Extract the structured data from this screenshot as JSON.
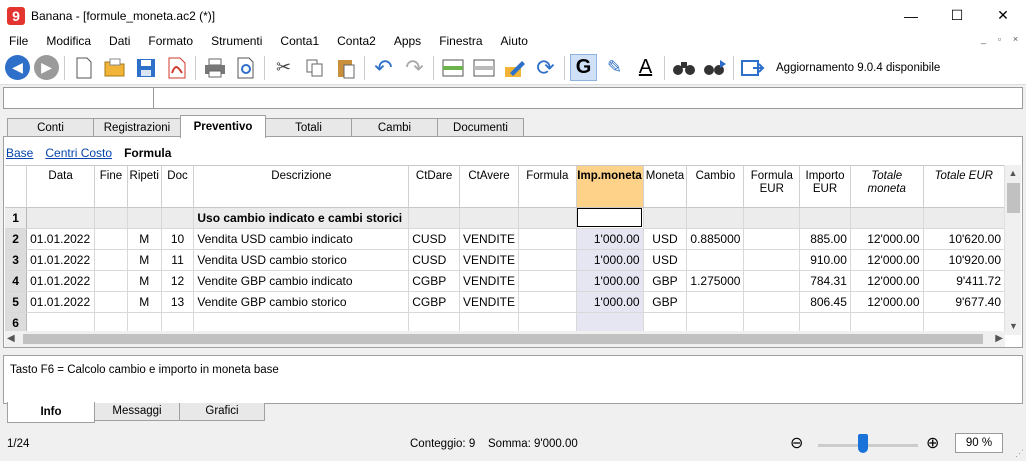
{
  "window": {
    "title": "Banana - [formule_moneta.ac2 (*)]",
    "logo": "9",
    "controls": [
      "—",
      "☐",
      "✕"
    ]
  },
  "menu": [
    "File",
    "Modifica",
    "Dati",
    "Formato",
    "Strumenti",
    "Conta1",
    "Conta2",
    "Apps",
    "Finestra",
    "Aiuto"
  ],
  "menu_right": [
    "_",
    "▫",
    "×"
  ],
  "toolbar": {
    "update_text": "Aggiornamento 9.0.4 disponibile",
    "bold_glyph": "G",
    "font_color_glyph": "A"
  },
  "tabs": [
    {
      "label": "Conti",
      "active": false
    },
    {
      "label": "Registrazioni",
      "active": false
    },
    {
      "label": "Preventivo",
      "active": true
    },
    {
      "label": "Totali",
      "active": false
    },
    {
      "label": "Cambi",
      "active": false
    },
    {
      "label": "Documenti",
      "active": false
    }
  ],
  "views": {
    "base": "Base",
    "centri": "Centri Costo",
    "formula": "Formula"
  },
  "columns": {
    "data": "Data",
    "fine": "Fine",
    "ripeti": "Ripeti",
    "doc": "Doc",
    "descrizione": "Descrizione",
    "ctdare": "CtDare",
    "ctavere": "CtAvere",
    "formula": "Formula",
    "imp_moneta": "Imp.moneta",
    "moneta": "Moneta",
    "cambio": "Cambio",
    "formula_eur": "Formula EUR",
    "importo_eur": "Importo EUR",
    "totale_moneta": "Totale moneta",
    "totale_eur": "Totale EUR"
  },
  "rows": [
    {
      "n": "1",
      "data": "",
      "fine": "",
      "ripeti": "",
      "doc": "",
      "descrizione": "Uso cambio indicato e cambi storici",
      "ctdare": "",
      "ctavere": "",
      "formula": "",
      "imp_moneta": "",
      "moneta": "",
      "cambio": "",
      "formula_eur": "",
      "importo_eur": "",
      "totale_moneta": "",
      "totale_eur": ""
    },
    {
      "n": "2",
      "data": "01.01.2022",
      "fine": "",
      "ripeti": "M",
      "doc": "10",
      "descrizione": "Vendita USD cambio indicato",
      "ctdare": "CUSD",
      "ctavere": "VENDITE",
      "formula": "",
      "imp_moneta": "1'000.00",
      "moneta": "USD",
      "cambio": "0.885000",
      "formula_eur": "",
      "importo_eur": "885.00",
      "totale_moneta": "12'000.00",
      "totale_eur": "10'620.00"
    },
    {
      "n": "3",
      "data": "01.01.2022",
      "fine": "",
      "ripeti": "M",
      "doc": "11",
      "descrizione": "Vendita USD cambio storico",
      "ctdare": "CUSD",
      "ctavere": "VENDITE",
      "formula": "",
      "imp_moneta": "1'000.00",
      "moneta": "USD",
      "cambio": "",
      "formula_eur": "",
      "importo_eur": "910.00",
      "totale_moneta": "12'000.00",
      "totale_eur": "10'920.00"
    },
    {
      "n": "4",
      "data": "01.01.2022",
      "fine": "",
      "ripeti": "M",
      "doc": "12",
      "descrizione": "Vendite GBP cambio indicato",
      "ctdare": "CGBP",
      "ctavere": "VENDITE",
      "formula": "",
      "imp_moneta": "1'000.00",
      "moneta": "GBP",
      "cambio": "1.275000",
      "formula_eur": "",
      "importo_eur": "784.31",
      "totale_moneta": "12'000.00",
      "totale_eur": "9'411.72"
    },
    {
      "n": "5",
      "data": "01.01.2022",
      "fine": "",
      "ripeti": "M",
      "doc": "13",
      "descrizione": "Vendite GBP cambio storico",
      "ctdare": "CGBP",
      "ctavere": "VENDITE",
      "formula": "",
      "imp_moneta": "1'000.00",
      "moneta": "GBP",
      "cambio": "",
      "formula_eur": "",
      "importo_eur": "806.45",
      "totale_moneta": "12'000.00",
      "totale_eur": "9'677.40"
    },
    {
      "n": "6",
      "data": "",
      "fine": "",
      "ripeti": "",
      "doc": "",
      "descrizione": "",
      "ctdare": "",
      "ctavere": "",
      "formula": "",
      "imp_moneta": "",
      "moneta": "",
      "cambio": "",
      "formula_eur": "",
      "importo_eur": "",
      "totale_moneta": "",
      "totale_eur": ""
    }
  ],
  "info_text": "Tasto F6 = Calcolo cambio e importo in moneta base",
  "bottom_tabs": [
    {
      "label": "Info",
      "active": true
    },
    {
      "label": "Messaggi",
      "active": false
    },
    {
      "label": "Grafici",
      "active": false
    }
  ],
  "status": {
    "page": "1/24",
    "count": "Conteggio: 9",
    "sum": "Somma: 9'000.00",
    "zoom": "90  %",
    "zoom_level": 0.45
  },
  "colors": {
    "accent": "#1a73d9",
    "highlight_header": "#ffd28a",
    "logo": "#e3342f"
  }
}
